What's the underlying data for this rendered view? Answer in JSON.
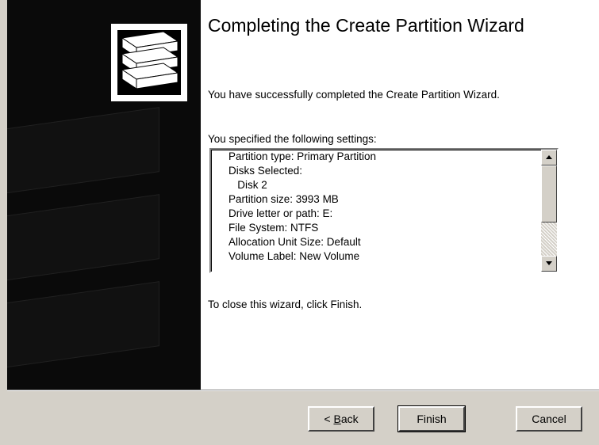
{
  "wizard": {
    "title": "Completing the Create Partition Wizard",
    "success_message": "You have successfully completed the Create Partition Wizard.",
    "settings_label": "You specified the following settings:",
    "settings": [
      "Partition type: Primary Partition",
      "Disks Selected:",
      "   Disk 2",
      "Partition size: 3993 MB",
      "Drive letter or path: E:",
      "File System: NTFS",
      "Allocation Unit Size: Default",
      "Volume Label: New Volume"
    ],
    "close_instruction": "To close this wizard, click Finish."
  },
  "buttons": {
    "back_prefix": "< ",
    "back_mnemonic": "B",
    "back_rest": "ack",
    "finish": "Finish",
    "cancel": "Cancel"
  },
  "icons": {
    "logo": "disk-stack-icon",
    "scroll_up": "scroll-up-arrow-icon",
    "scroll_down": "scroll-down-arrow-icon"
  },
  "colors": {
    "dialog_face": "#d4d0c8",
    "side_panel": "#0a0a0a",
    "content_bg": "#ffffff"
  }
}
